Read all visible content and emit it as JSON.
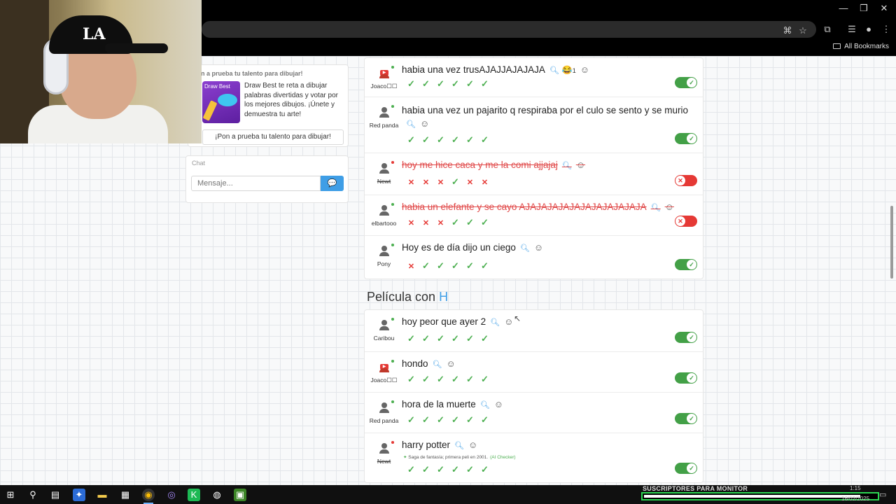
{
  "browser": {
    "bookmarks_label": "All Bookmarks"
  },
  "promo": {
    "title": "n a prueba tu talento para dibujar!",
    "image_label": "Draw Best",
    "description": "Draw Best te reta a dibujar palabras divertidas y votar por los mejores dibujos. ¡Únete y demuestra tu arte!",
    "button": "¡Pon a prueba tu talento para dibujar!"
  },
  "chat": {
    "title": "Chat",
    "placeholder": "Mensaje..."
  },
  "panel1": {
    "rows": [
      {
        "user": "Joaco☐☐",
        "avatar": "youtube-avatar",
        "online": true,
        "answer": "habia una vez trusAJAJJAJAJAJA",
        "reaction_emoji": "😂",
        "reaction_count": "1",
        "votes": [
          "ok",
          "ok",
          "ok",
          "ok",
          "ok",
          "ok"
        ],
        "accepted": true
      },
      {
        "user": "Red panda",
        "avatar": "user-avatar",
        "online": true,
        "answer": "habia una vez un pajarito q respiraba por el culo se sento y se murio",
        "votes": [
          "ok",
          "ok",
          "ok",
          "ok",
          "ok",
          "ok"
        ],
        "accepted": true
      },
      {
        "user": "Newt",
        "avatar": "user-avatar",
        "online": false,
        "answer": "hoy me hice caca y me la comi ajjajaj",
        "votes": [
          "no",
          "no",
          "no",
          "ok",
          "no",
          "no"
        ],
        "accepted": false
      },
      {
        "user": "elbartooo",
        "avatar": "user-avatar",
        "online": true,
        "answer": "habia un elefante y se cayo AJAJAJAJAJAJAJAJAJAJAJA",
        "votes": [
          "no",
          "no",
          "no",
          "ok",
          "ok",
          "ok"
        ],
        "accepted": false
      },
      {
        "user": "Pony",
        "avatar": "user-avatar",
        "online": true,
        "answer": "Hoy es de día dijo un ciego",
        "votes": [
          "no",
          "ok",
          "ok",
          "ok",
          "ok",
          "ok"
        ],
        "accepted": true
      }
    ]
  },
  "section": {
    "title": "Película con ",
    "letter": "H"
  },
  "panel2": {
    "rows": [
      {
        "user": "Caribou",
        "avatar": "user-avatar",
        "online": true,
        "answer": "hoy peor que ayer 2",
        "votes": [
          "ok",
          "ok",
          "ok",
          "ok",
          "ok",
          "ok"
        ],
        "accepted": true
      },
      {
        "user": "Joaco☐☐",
        "avatar": "youtube-avatar",
        "online": true,
        "answer": "hondo",
        "votes": [
          "ok",
          "ok",
          "ok",
          "ok",
          "ok",
          "ok"
        ],
        "accepted": true
      },
      {
        "user": "Red panda",
        "avatar": "user-avatar",
        "online": true,
        "answer": "hora de la muerte",
        "votes": [
          "ok",
          "ok",
          "ok",
          "ok",
          "ok",
          "ok"
        ],
        "accepted": true
      },
      {
        "user": "Newt",
        "avatar": "user-avatar",
        "online": false,
        "answer": "harry potter",
        "ai_note": "Saga de fantasía; primera peli en 2001.",
        "ai_checker": "(AI Checker)",
        "votes": [
          "ok",
          "ok",
          "ok",
          "ok",
          "ok",
          "ok"
        ],
        "accepted": true
      }
    ]
  },
  "taskbar": {
    "subscriber_label": "SUSCRIPTORES PARA MONITOR",
    "subscriber_progress": 0.92,
    "time": "1:15",
    "date": "16/02/2025"
  },
  "colors": {
    "accent": "#3f9ee6",
    "ok": "#4caf50",
    "error": "#e53935",
    "toggle_on": "#43a047"
  }
}
